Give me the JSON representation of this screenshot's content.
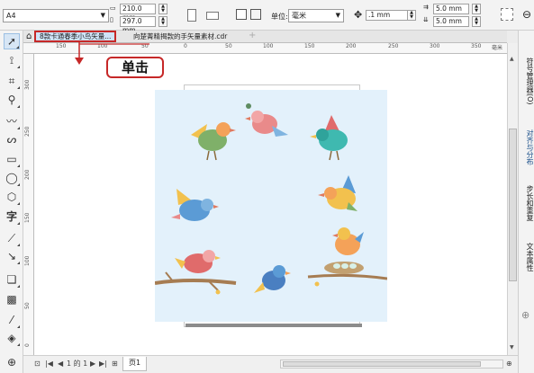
{
  "propbar": {
    "paper_size": "A4",
    "width_value": "210.0 mm",
    "height_value": "297.0 mm",
    "units_label": "单位:",
    "units_value": "毫米",
    "nudge_value": ".1 mm",
    "dup_x": "5.0 mm",
    "dup_y": "5.0 mm"
  },
  "tabs": {
    "active": "8款卡通春季小鸟矢量...",
    "other": "向楚菁精揭款的手矢量素材.cdr",
    "plus": "+"
  },
  "ruler": {
    "h_numbers": [
      "150",
      "100",
      "50",
      "0",
      "50",
      "100",
      "150",
      "200",
      "250",
      "300",
      "350"
    ],
    "h_unit": "毫米",
    "v_numbers": [
      "300",
      "250",
      "200",
      "150",
      "100",
      "50",
      "0"
    ]
  },
  "callout": {
    "text": "单击"
  },
  "docker": {
    "tabs": [
      "符号管理器(O)",
      "对齐与分布",
      "步长和重复",
      "文本属性"
    ]
  },
  "status": {
    "page_counter": "1 的 1",
    "page_tab": "页1"
  },
  "colors": {
    "artboard": "#e3f1fb",
    "highlight_border": "#c62828",
    "active_tab": "#cfe3f7"
  }
}
